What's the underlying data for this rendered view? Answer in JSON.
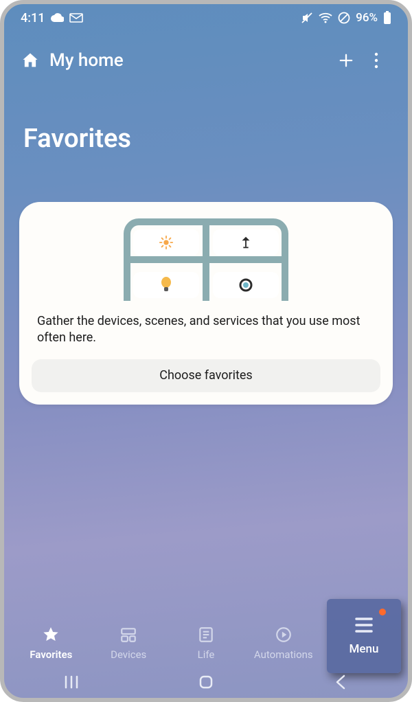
{
  "status": {
    "time": "4:11",
    "battery_pct": "96%"
  },
  "topbar": {
    "home_label": "My home"
  },
  "page": {
    "title": "Favorites"
  },
  "card": {
    "body_text": "Gather the devices, scenes, and services that you use most often here.",
    "choose_label": "Choose favorites"
  },
  "nav": {
    "items": [
      {
        "label": "Favorites"
      },
      {
        "label": "Devices"
      },
      {
        "label": "Life"
      },
      {
        "label": "Automations"
      },
      {
        "label": "Menu"
      }
    ]
  }
}
